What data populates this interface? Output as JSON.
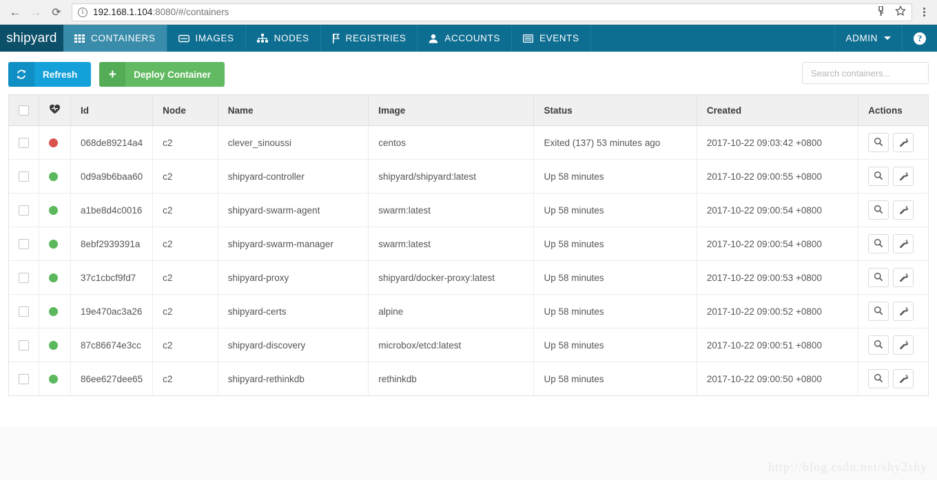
{
  "browser": {
    "back_icon": "back-arrow-icon",
    "forward_icon": "forward-arrow-icon",
    "reload_icon": "reload-icon",
    "info_glyph": "i",
    "url_host": "192.168.1.104",
    "url_rest": ":8080/#/containers",
    "key_icon": "key-icon",
    "star_icon": "star-icon",
    "menu_icon": "kebab-menu-icon"
  },
  "navbar": {
    "brand": "shipyard",
    "items": [
      {
        "label": "CONTAINERS",
        "icon": "grid-icon",
        "active": true
      },
      {
        "label": "IMAGES",
        "icon": "image-icon",
        "active": false
      },
      {
        "label": "NODES",
        "icon": "sitemap-icon",
        "active": false
      },
      {
        "label": "REGISTRIES",
        "icon": "flag-icon",
        "active": false
      },
      {
        "label": "ACCOUNTS",
        "icon": "user-icon",
        "active": false
      },
      {
        "label": "EVENTS",
        "icon": "list-icon",
        "active": false
      }
    ],
    "user_label": "ADMIN",
    "user_caret": "chevron-down-icon",
    "help_glyph": "?",
    "bg_color": "#0e6e91",
    "brand_bg_color": "#0b4f68",
    "active_bg_color": "#3a8cab"
  },
  "toolbar": {
    "refresh_label": "Refresh",
    "refresh_icon": "refresh-icon",
    "refresh_color": "#14a0d8",
    "deploy_label": "Deploy Container",
    "deploy_icon": "plus-icon",
    "deploy_color": "#62ba62"
  },
  "search": {
    "value": "",
    "placeholder": "Search containers...",
    "clear_glyph": "✕"
  },
  "table": {
    "columns": [
      {
        "key": "check",
        "label": ""
      },
      {
        "key": "state",
        "label": ""
      },
      {
        "key": "id",
        "label": "Id"
      },
      {
        "key": "node",
        "label": "Node"
      },
      {
        "key": "name",
        "label": "Name"
      },
      {
        "key": "image",
        "label": "Image"
      },
      {
        "key": "status",
        "label": "Status"
      },
      {
        "key": "created",
        "label": "Created"
      },
      {
        "key": "actions",
        "label": "Actions"
      }
    ],
    "header_state_icon": "heartbeat-icon",
    "state_colors": {
      "running": "#5cb85c",
      "exited": "#d9534f"
    },
    "row_actions": [
      {
        "icon": "magnifier-icon",
        "name": "inspect-button"
      },
      {
        "icon": "wrench-icon",
        "name": "settings-button"
      }
    ],
    "rows": [
      {
        "state": "exited",
        "id": "068de89214a4",
        "node": "c2",
        "name": "clever_sinoussi",
        "image": "centos",
        "status": "Exited (137) 53 minutes ago",
        "created": "2017-10-22 09:03:42 +0800"
      },
      {
        "state": "running",
        "id": "0d9a9b6baa60",
        "node": "c2",
        "name": "shipyard-controller",
        "image": "shipyard/shipyard:latest",
        "status": "Up 58 minutes",
        "created": "2017-10-22 09:00:55 +0800"
      },
      {
        "state": "running",
        "id": "a1be8d4c0016",
        "node": "c2",
        "name": "shipyard-swarm-agent",
        "image": "swarm:latest",
        "status": "Up 58 minutes",
        "created": "2017-10-22 09:00:54 +0800"
      },
      {
        "state": "running",
        "id": "8ebf2939391a",
        "node": "c2",
        "name": "shipyard-swarm-manager",
        "image": "swarm:latest",
        "status": "Up 58 minutes",
        "created": "2017-10-22 09:00:54 +0800"
      },
      {
        "state": "running",
        "id": "37c1cbcf9fd7",
        "node": "c2",
        "name": "shipyard-proxy",
        "image": "shipyard/docker-proxy:latest",
        "status": "Up 58 minutes",
        "created": "2017-10-22 09:00:53 +0800"
      },
      {
        "state": "running",
        "id": "19e470ac3a26",
        "node": "c2",
        "name": "shipyard-certs",
        "image": "alpine",
        "status": "Up 58 minutes",
        "created": "2017-10-22 09:00:52 +0800"
      },
      {
        "state": "running",
        "id": "87c86674e3cc",
        "node": "c2",
        "name": "shipyard-discovery",
        "image": "microbox/etcd:latest",
        "status": "Up 58 minutes",
        "created": "2017-10-22 09:00:51 +0800"
      },
      {
        "state": "running",
        "id": "86ee627dee65",
        "node": "c2",
        "name": "shipyard-rethinkdb",
        "image": "rethinkdb",
        "status": "Up 58 minutes",
        "created": "2017-10-22 09:00:50 +0800"
      }
    ]
  },
  "watermark": "http://blog.csdn.net/shy2shy"
}
